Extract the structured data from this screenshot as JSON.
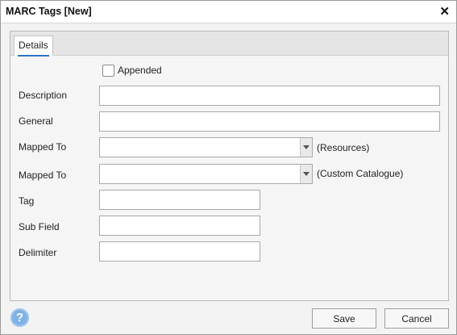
{
  "dialog": {
    "title": "MARC Tags [New]",
    "close_glyph": "✕"
  },
  "tabs": [
    {
      "label": "Details"
    }
  ],
  "form": {
    "appended_label": "Appended",
    "appended_checked": false,
    "description_label": "Description",
    "description_value": "",
    "general_label": "General",
    "general_value": "",
    "mapped_to_1_label": "Mapped To",
    "mapped_to_1_value": "",
    "mapped_to_1_hint": "(Resources)",
    "mapped_to_2_label": "Mapped To",
    "mapped_to_2_value": "",
    "mapped_to_2_hint": "(Custom Catalogue)",
    "tag_label": "Tag",
    "tag_value": "",
    "subfield_label": "Sub Field",
    "subfield_value": "",
    "delimiter_label": "Delimiter",
    "delimiter_value": ""
  },
  "footer": {
    "help_glyph": "?",
    "save_label": "Save",
    "cancel_label": "Cancel"
  },
  "colors": {
    "tab_accent": "#2a74c9",
    "help_icon": "#7fb3e6"
  },
  "icons": {
    "close": "close-icon",
    "help": "help-icon",
    "dropdown": "chevron-down-icon"
  }
}
